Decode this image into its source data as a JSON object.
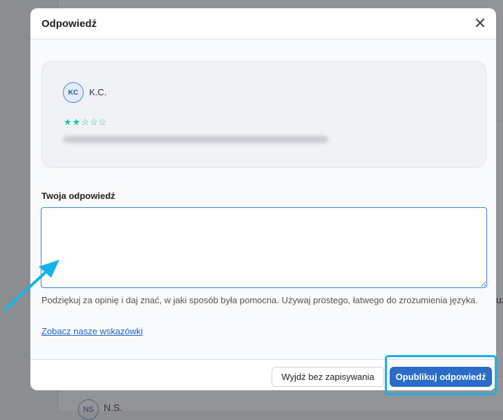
{
  "background": {
    "avatar_initials": "NS",
    "name": "N.S.",
    "edge_text": "uż"
  },
  "modal": {
    "title": "Odpowiedź",
    "close_icon": "close-icon",
    "review": {
      "avatar_initials": "KC",
      "author": "K.C.",
      "rating": 2,
      "max_rating": 5,
      "text_blurred": true
    },
    "reply_label": "Twoja odpowiedź",
    "reply_value": "",
    "help_text": "Podziękuj za opinię i daj znać, w jaki sposób była pomocna. Używaj prostego, łatwego do zrozumienia języka.",
    "guidelines_link": "Zobacz nasze wskazówki",
    "footer": {
      "cancel_label": "Wyjdź bez zapisywania",
      "publish_label": "Opublikuj odpowiedź"
    }
  },
  "colors": {
    "accent": "#2a6cc8",
    "stars": "#14c3a0",
    "annotation": "#15b3ea"
  }
}
